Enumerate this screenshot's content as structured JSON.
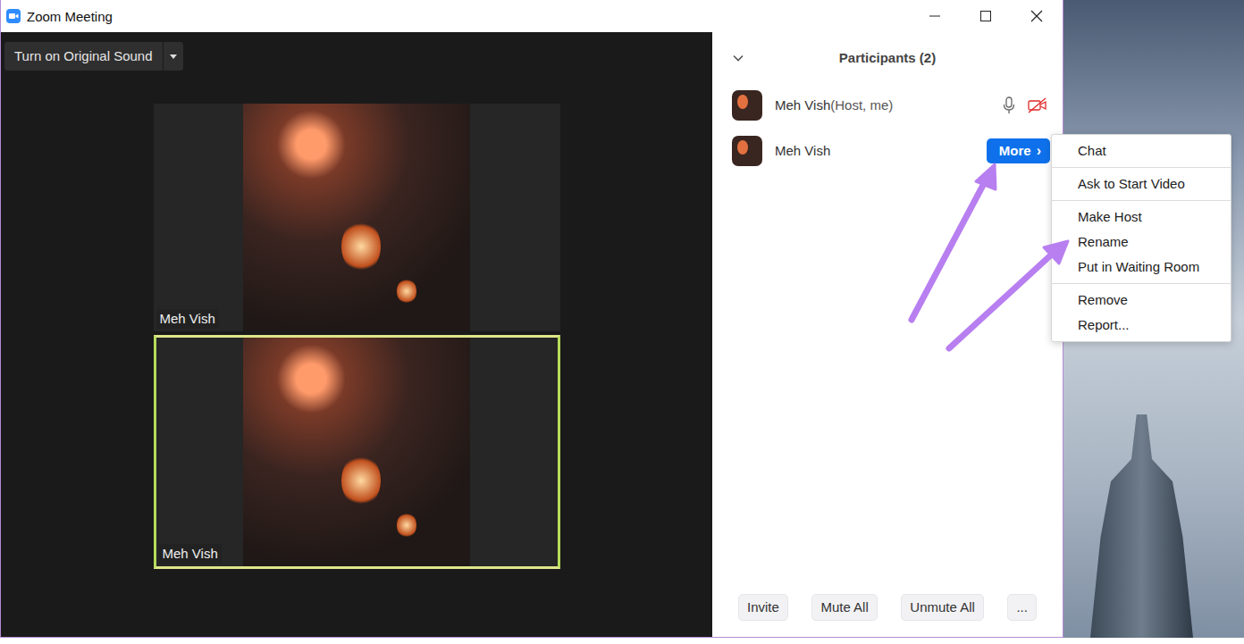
{
  "window": {
    "title": "Zoom Meeting"
  },
  "audio_button": {
    "label": "Turn on Original Sound"
  },
  "videos": [
    {
      "name": "Meh Vish",
      "speaking": false
    },
    {
      "name": "Meh Vish",
      "speaking": true
    }
  ],
  "participants": {
    "title": "Participants (2)",
    "items": [
      {
        "name": "Meh Vish",
        "role": "(Host, me)",
        "hovered": false,
        "audio_on": true,
        "video_on": false
      },
      {
        "name": "Meh Vish",
        "role": "",
        "hovered": true
      }
    ],
    "more_button": {
      "label": "More",
      "arrow": "›"
    }
  },
  "menu": {
    "groups": [
      [
        "Chat"
      ],
      [
        "Ask to Start Video"
      ],
      [
        "Make Host",
        "Rename",
        "Put in Waiting Room"
      ],
      [
        "Remove",
        "Report..."
      ]
    ]
  },
  "footer_buttons": [
    "Invite",
    "Mute All",
    "Unmute All",
    "..."
  ]
}
